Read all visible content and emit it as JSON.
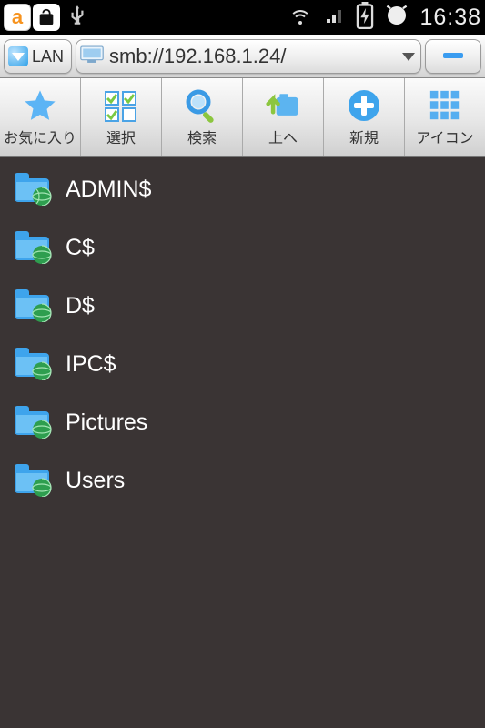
{
  "status_bar": {
    "clock": "16:38"
  },
  "address_bar": {
    "connection_label": "LAN",
    "path": "smb://192.168.1.24/"
  },
  "toolbar": [
    {
      "id": "favorites",
      "label": "お気に入り"
    },
    {
      "id": "select",
      "label": "選択"
    },
    {
      "id": "search",
      "label": "検索"
    },
    {
      "id": "up",
      "label": "上へ"
    },
    {
      "id": "new",
      "label": "新規"
    },
    {
      "id": "icons",
      "label": "アイコン"
    }
  ],
  "files": [
    {
      "name": "ADMIN$",
      "kind": "network-share"
    },
    {
      "name": "C$",
      "kind": "network-share"
    },
    {
      "name": "D$",
      "kind": "network-share"
    },
    {
      "name": "IPC$",
      "kind": "network-share"
    },
    {
      "name": "Pictures",
      "kind": "network-share"
    },
    {
      "name": "Users",
      "kind": "network-share"
    }
  ]
}
